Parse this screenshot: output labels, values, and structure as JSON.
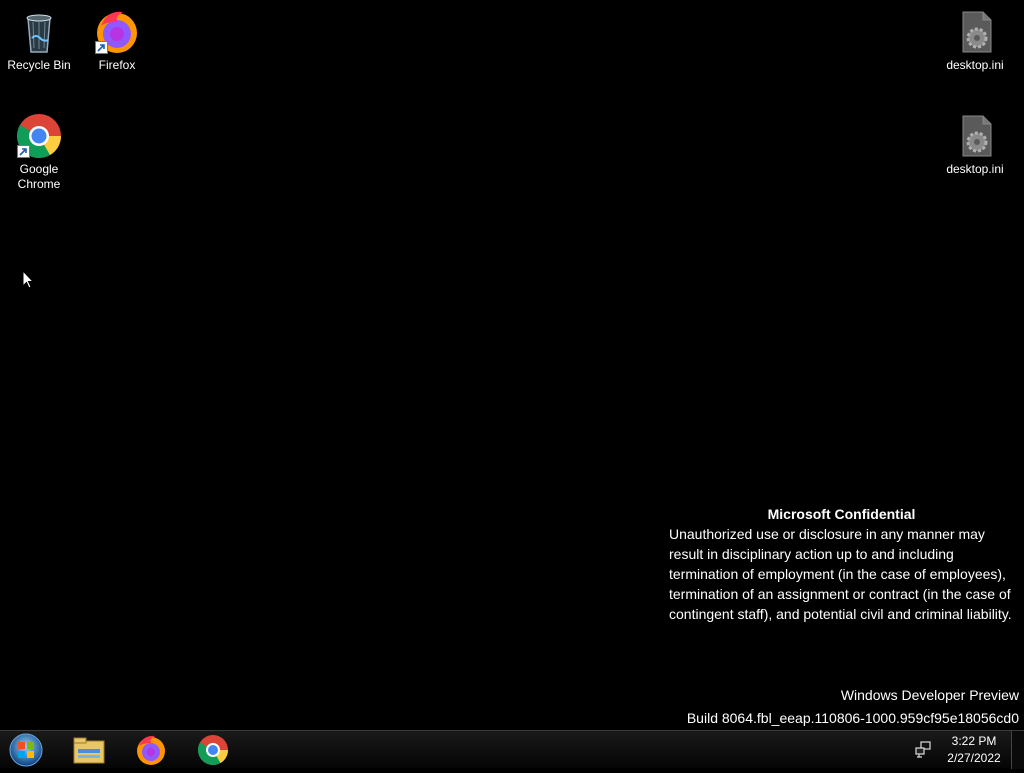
{
  "desktop": {
    "icons": [
      {
        "label": "Recycle Bin",
        "icon": "recycle-bin-icon"
      },
      {
        "label": "Firefox",
        "icon": "firefox-icon"
      },
      {
        "label": "Google Chrome",
        "icon": "chrome-icon"
      },
      {
        "label": "desktop.ini",
        "icon": "settings-file-icon"
      },
      {
        "label": "desktop.ini",
        "icon": "settings-file-icon"
      }
    ]
  },
  "watermark": {
    "title": "Microsoft Confidential",
    "body": "Unauthorized use or disclosure in any manner may result in disciplinary action up to and including termination of employment (in the case of employees), termination of an assignment or contract (in the case of contingent staff), and potential civil and criminal liability.",
    "edition": "Windows Developer Preview",
    "build": "Build 8064.fbl_eeap.110806-1000.959cf95e18056cd0"
  },
  "taskbar": {
    "start": "start-orb-icon",
    "pinned": [
      "file-explorer-icon",
      "firefox-icon",
      "chrome-icon"
    ],
    "clock": {
      "time": "3:22 PM",
      "date": "2/27/2022"
    }
  },
  "colors": {
    "background": "#000000",
    "text": "#ffffff"
  }
}
